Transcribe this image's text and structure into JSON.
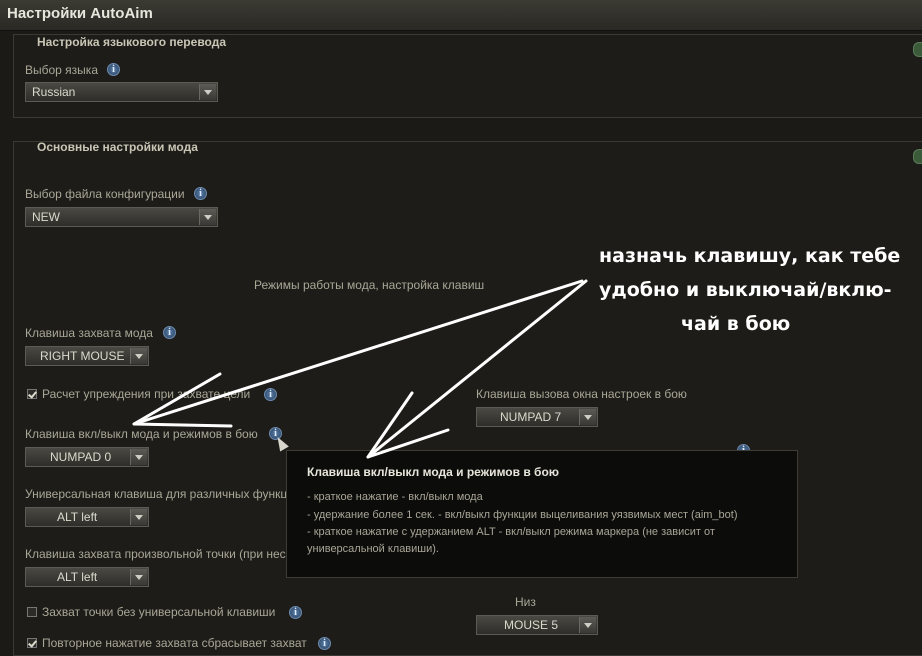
{
  "window": {
    "title": "Настройки AutoAim"
  },
  "language_section": {
    "title": "Настройка языкового перевода",
    "language_label": "Выбор языка",
    "language_value": "Russian"
  },
  "main_section": {
    "title": "Основные настройки мода",
    "config_label": "Выбор файла конфигурации",
    "config_value": "NEW",
    "modes_heading": "Режимы работы мода, настройка клавиш",
    "capture_key_label": "Клавиша захвата мода",
    "capture_key_value": "RIGHT MOUSE",
    "lead_checkbox_label": "Расчет упреждения при захвате цели",
    "lead_checked": true,
    "settings_window_key_label": "Клавиша вызова окна настроек в бою",
    "settings_window_key_value": "NUMPAD 7",
    "toggle_key_label": "Клавиша вкл/выкл мода и режимов в бою",
    "toggle_key_value": "NUMPAD 0",
    "universal_key_label": "Универсальная клавиша для различных функций",
    "universal_key_value": "ALT left",
    "point_capture_key_label": "Клавиша захвата произвольной точки (при нес",
    "point_capture_key_value": "ALT left",
    "capture_no_universal_label": "Захват точки без универсальной клавиши",
    "capture_no_universal_checked": false,
    "down_label": "Низ",
    "down_value": "MOUSE 5",
    "repeat_reset_label": "Повторное нажатие захвата сбрасывает захват",
    "repeat_reset_checked": true
  },
  "tooltip": {
    "title": "Клавиша вкл/выкл мода и режимов в бою",
    "lines": [
      "- краткое нажатие - вкл/выкл мода",
      "- удержание более 1 сек. - вкл/выкл функции выцеливания уязвимых мест (aim_bot)",
      "- краткое нажатие с удержанием ALT - вкл/выкл режима маркера (не зависит от",
      "универсальной клавиши)."
    ]
  },
  "annotation": {
    "lines": [
      "назначь клавишу, как тебе",
      "удобно и выключай/вклю-",
      "чай в бою"
    ]
  },
  "icons": {
    "info": "i"
  }
}
